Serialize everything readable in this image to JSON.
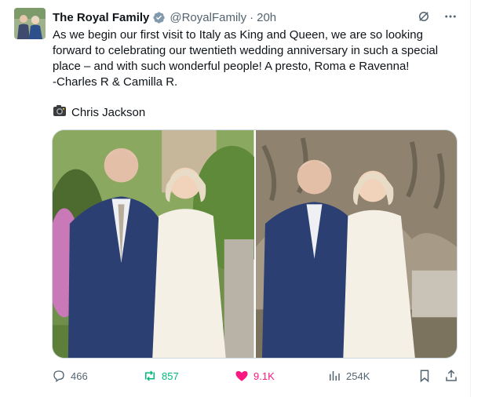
{
  "tweet": {
    "author_name": "The Royal Family",
    "handle": "@RoyalFamily",
    "separator": "·",
    "time": "20h",
    "text": "As we begin our first visit to Italy as King and Queen, we are so looking forward to celebrating our twentieth wedding anniversary in such a special place – and with such wonderful people! A presto, Roma e Ravenna!\n-Charles R & Camilla R.",
    "credit": "Chris Jackson"
  },
  "actions": {
    "replies": "466",
    "reposts": "857",
    "likes": "9.1K",
    "views": "254K"
  },
  "colors": {
    "repost_active": "#00ba7c",
    "like_active": "#f91880",
    "verified_badge": "#829aab",
    "muted": "#536471"
  },
  "icons": [
    "verified-badge-icon",
    "grok-icon",
    "more-icon",
    "camera-icon",
    "reply-icon",
    "repost-icon",
    "like-icon",
    "views-icon",
    "bookmark-icon",
    "share-icon"
  ]
}
